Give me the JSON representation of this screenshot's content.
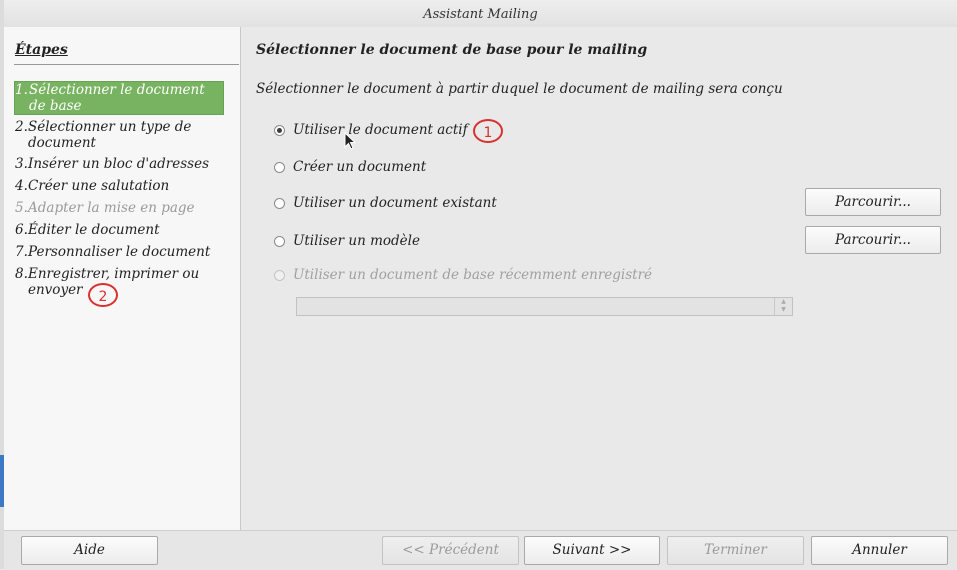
{
  "window": {
    "title": "Assistant Mailing"
  },
  "sidebar": {
    "heading": "Étapes",
    "steps": [
      {
        "num": "1.",
        "label": "Sélectionner le document de base",
        "state": "active"
      },
      {
        "num": "2.",
        "label": "Sélectionner un type de document",
        "state": "normal"
      },
      {
        "num": "3.",
        "label": "Insérer un bloc d'adresses",
        "state": "normal"
      },
      {
        "num": "4.",
        "label": "Créer une salutation",
        "state": "normal"
      },
      {
        "num": "5.",
        "label": "Adapter la mise en page",
        "state": "disabled"
      },
      {
        "num": "6.",
        "label": "Éditer le document",
        "state": "normal"
      },
      {
        "num": "7.",
        "label": "Personnaliser le document",
        "state": "normal"
      },
      {
        "num": "8.",
        "label": "Enregistrer, imprimer ou envoyer",
        "state": "normal"
      }
    ]
  },
  "main": {
    "title": "Sélectionner le document de base pour le mailing",
    "subtitle": "Sélectionner le document à partir duquel le document de mailing sera conçu",
    "options": [
      {
        "label": "Utiliser le document actif",
        "checked": true
      },
      {
        "label": "Créer un document",
        "checked": false
      },
      {
        "label": "Utiliser un document existant",
        "checked": false
      },
      {
        "label": "Utiliser un modèle",
        "checked": false
      },
      {
        "label": "Utiliser un document de base récemment enregistré",
        "checked": false,
        "disabled": true
      }
    ],
    "browse_label": "Parcourir..."
  },
  "annotations": {
    "one": "1",
    "two": "2",
    "color": "#d93030"
  },
  "footer": {
    "help": "Aide",
    "previous": "<< Précédent",
    "next": "Suivant >>",
    "finish": "Terminer",
    "cancel": "Annuler"
  },
  "colors": {
    "active_step": "#78b361"
  }
}
